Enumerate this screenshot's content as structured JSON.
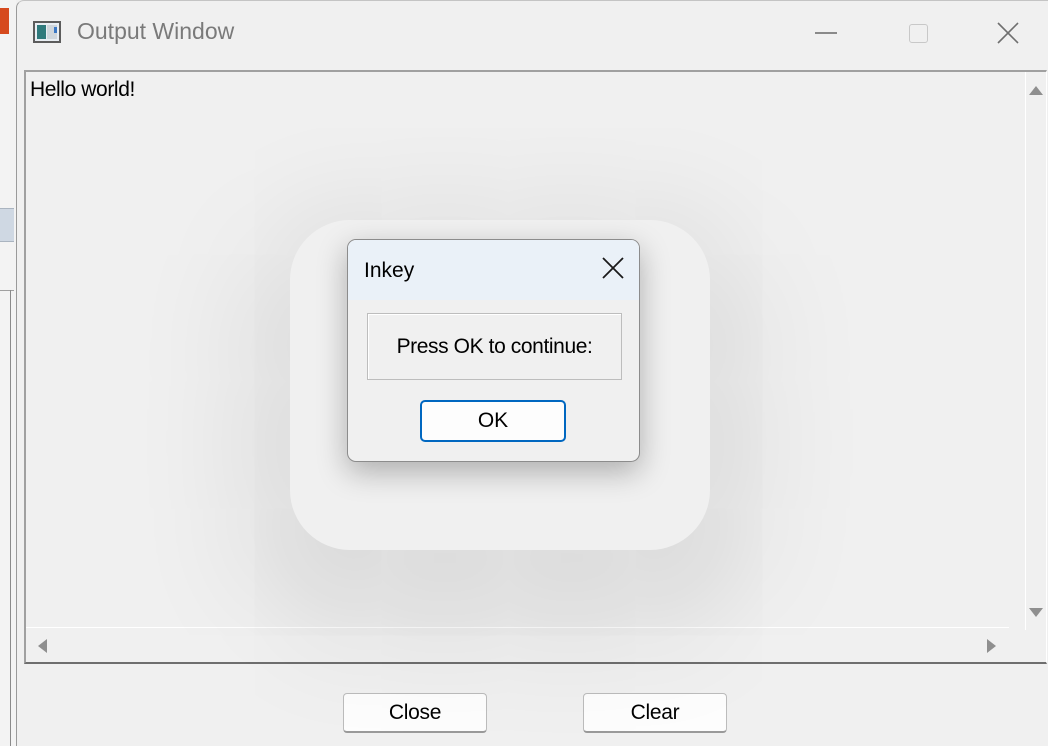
{
  "window": {
    "title": "Output Window",
    "icon": "app-window-icon",
    "controls": [
      "minimize-icon",
      "maximize-icon",
      "close-icon"
    ]
  },
  "output": {
    "text": "Hello world!"
  },
  "buttons": {
    "close_label": "Close",
    "clear_label": "Clear"
  },
  "dialog": {
    "title": "Inkey",
    "message": "Press OK to continue:",
    "ok_label": "OK",
    "accent": "#0067c0"
  }
}
